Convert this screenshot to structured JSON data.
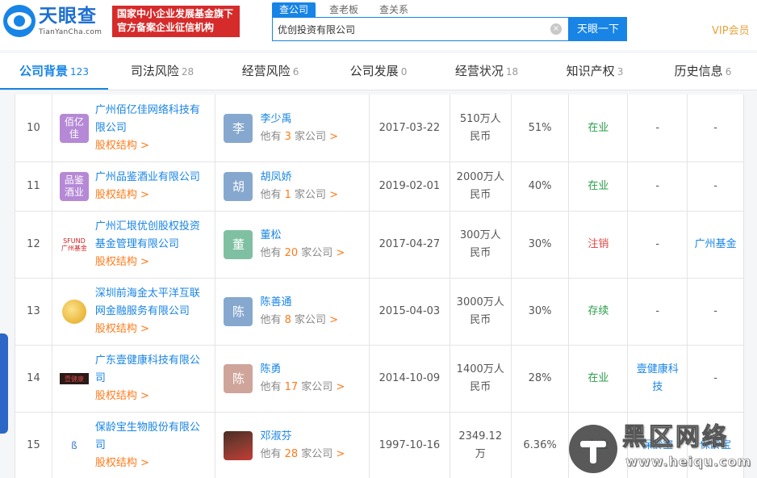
{
  "header": {
    "logo_text": "天眼查",
    "logo_sub": "TianYanCha.com",
    "banner_line1": "国家中小企业发展基金旗下",
    "banner_line2": "官方备案企业征信机构",
    "search_tabs": [
      "查公司",
      "查老板",
      "查关系"
    ],
    "search_value": "优创投资有限公司",
    "search_button": "天眼一下",
    "vip": "VIP会员"
  },
  "tabs": [
    {
      "label": "公司背景",
      "count": "123"
    },
    {
      "label": "司法风险",
      "count": "28"
    },
    {
      "label": "经营风险",
      "count": "6"
    },
    {
      "label": "公司发展",
      "count": "0"
    },
    {
      "label": "经营状况",
      "count": "18"
    },
    {
      "label": "知识产权",
      "count": "3"
    },
    {
      "label": "历史信息",
      "count": "6"
    }
  ],
  "rows": [
    {
      "idx": "10",
      "logo": "佰亿佳",
      "name1": "广州佰亿佳网络科技有",
      "name2": "限公司",
      "equity": "股权结构 >",
      "avatar": "李",
      "person": "李少禹",
      "more_pre": "他有 ",
      "more_num": "3",
      "more_post": " 家公司",
      "date": "2017-03-22",
      "cap1": "510万人",
      "cap2": "民币",
      "ratio": "51%",
      "status": "在业",
      "brand": "-",
      "inst": "-"
    },
    {
      "idx": "11",
      "logo": "品鉴酒业",
      "name1": "广州品鉴酒业有限公司",
      "name2": "",
      "equity": "股权结构 >",
      "avatar": "胡",
      "person": "胡凤娇",
      "more_pre": "他有 ",
      "more_num": "1",
      "more_post": " 家公司",
      "date": "2019-02-01",
      "cap1": "2000万人",
      "cap2": "民币",
      "ratio": "40%",
      "status": "在业",
      "brand": "-",
      "inst": "-"
    },
    {
      "idx": "12",
      "logo": "SFUND 广州基金",
      "name1": "广州汇垠优创股权投资",
      "name2": "基金管理有限公司",
      "equity": "股权结构 >",
      "avatar": "董",
      "person": "董松",
      "more_pre": "他有 ",
      "more_num": "20",
      "more_post": " 家公司",
      "date": "2017-04-27",
      "cap1": "300万人",
      "cap2": "民币",
      "ratio": "30%",
      "status": "注销",
      "brand": "-",
      "inst": "广州基金"
    },
    {
      "idx": "13",
      "logo": "",
      "name1": "深圳前海金太平洋互联",
      "name2": "网金融服务有限公司",
      "equity": "股权结构 >",
      "avatar": "陈",
      "person": "陈善通",
      "more_pre": "他有 ",
      "more_num": "8",
      "more_post": " 家公司",
      "date": "2015-04-03",
      "cap1": "3000万人",
      "cap2": "民币",
      "ratio": "30%",
      "status": "存续",
      "brand": "-",
      "inst": "-"
    },
    {
      "idx": "14",
      "logo": "壹健康",
      "name1": "广东壹健康科技有限公",
      "name2": "司",
      "equity": "股权结构 >",
      "avatar": "陈",
      "person": "陈勇",
      "more_pre": "他有 ",
      "more_num": "17",
      "more_post": " 家公司",
      "date": "2014-10-09",
      "cap1": "1400万人",
      "cap2": "民币",
      "ratio": "28%",
      "status": "在业",
      "brand1": "壹健康科",
      "brand2": "技",
      "inst": "-"
    },
    {
      "idx": "15",
      "logo": "ß",
      "name1": "保龄宝生物股份有限公",
      "name2": "司",
      "equity": "股权结构 >",
      "avatar": "",
      "person": "邓淑芬",
      "more_pre": "他有 ",
      "more_num": "28",
      "more_post": " 家公司",
      "date": "1997-10-16",
      "cap1": "2349.12",
      "cap2": "万",
      "ratio": "6.36%",
      "status": "在业",
      "brand": "保龄宝",
      "inst": "保龄宝"
    }
  ],
  "watermark": {
    "title": "黑区网络",
    "url": "www.heiqu.com"
  },
  "colors": {
    "brand_blue": "#1784e6",
    "banner_red": "#d62b2b",
    "status_green": "#2aa04a",
    "status_red": "#e24a4a",
    "link_orange": "#ff7a1a",
    "vip_gold": "#e8a33c"
  }
}
